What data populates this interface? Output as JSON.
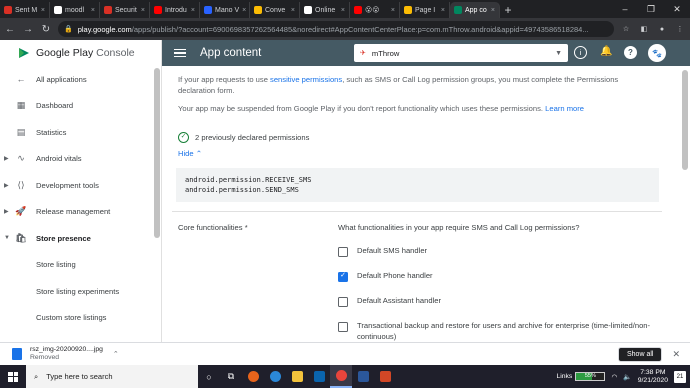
{
  "browser": {
    "tabs": [
      {
        "label": "Sent M",
        "icon": "gmail-icon",
        "color": "#d93025"
      },
      {
        "label": "moodl",
        "icon": "github-icon",
        "color": "#ffffff"
      },
      {
        "label": "Securit",
        "icon": "gmail-icon",
        "color": "#d93025"
      },
      {
        "label": "Introdu",
        "icon": "youtube-icon",
        "color": "#ff0000"
      },
      {
        "label": "Mano V",
        "icon": "m-icon",
        "color": "#2962ff"
      },
      {
        "label": "Conve",
        "icon": "convert-icon",
        "color": "#fbbc04"
      },
      {
        "label": "Online",
        "icon": "github-icon",
        "color": "#ffffff"
      },
      {
        "label": "😮😮",
        "icon": "youtube-icon",
        "color": "#ff0000"
      },
      {
        "label": "Page I",
        "icon": "doc-icon",
        "color": "#fbbc04"
      },
      {
        "label": "App co",
        "icon": "play-console-icon",
        "color": "#01875f",
        "active": true
      }
    ],
    "new_tab": "+",
    "window_controls": [
      "–",
      "❐",
      "✕"
    ],
    "url_host": "play.google.com",
    "url_path": "/apps/publish/?account=6900698357262564485&noredirect#AppContentCenterPlace:p=com.mThrow.android&appid=49743586518284..."
  },
  "sidebar": {
    "brand_prefix": "Google Play",
    "brand_suffix": "Console",
    "items": [
      {
        "label": "All applications",
        "icon": "←"
      },
      {
        "label": "Dashboard",
        "icon": "▦"
      },
      {
        "label": "Statistics",
        "icon": "▤"
      },
      {
        "label": "Android vitals",
        "icon": "∿",
        "caret": true
      },
      {
        "label": "Development tools",
        "icon": "⟨⟩",
        "caret": true
      },
      {
        "label": "Release management",
        "icon": "🚀",
        "caret": true
      },
      {
        "label": "Store presence",
        "icon": "🛍",
        "caret": true,
        "open": true
      }
    ],
    "subitems": [
      "Store listing",
      "Store listing experiments",
      "Custom store listings"
    ]
  },
  "topbar": {
    "title": "App content",
    "app_name": "mThrow",
    "account_initials": "🐾"
  },
  "content": {
    "intro_prefix": "If your app requests to use ",
    "intro_link": "sensitive permissions",
    "intro_suffix": ", such as SMS or Call Log permission groups, you must complete the Permissions declaration form.",
    "suspend_text": "Your app may be suspended from Google Play if you don't report functionality which uses these permissions.",
    "learn_more": "Learn more",
    "declared_text": "2 previously declared permissions",
    "hide_label": "Hide",
    "permissions": [
      "android.permission.RECEIVE_SMS",
      "android.permission.SEND_SMS"
    ],
    "core_label": "Core functionalities  *",
    "question": "What functionalities in your app require SMS and Call Log permissions?",
    "options": [
      {
        "label": "Default SMS handler",
        "checked": false
      },
      {
        "label": "Default Phone handler",
        "checked": true
      },
      {
        "label": "Default Assistant handler",
        "checked": false
      },
      {
        "label": "Transactional backup and restore for users and archive for enterprise (time-limited/non-continuous)",
        "checked": false
      }
    ]
  },
  "download": {
    "file": "rsz_img-20200920....jpg",
    "status": "Removed",
    "show_all": "Show all"
  },
  "taskbar": {
    "search_placeholder": "Type here to search",
    "links_label": "Links",
    "meter_text": "55%",
    "meter_value": 0.55,
    "time": "7:38 PM",
    "date": "9/21/2020",
    "notification_count": "21"
  }
}
